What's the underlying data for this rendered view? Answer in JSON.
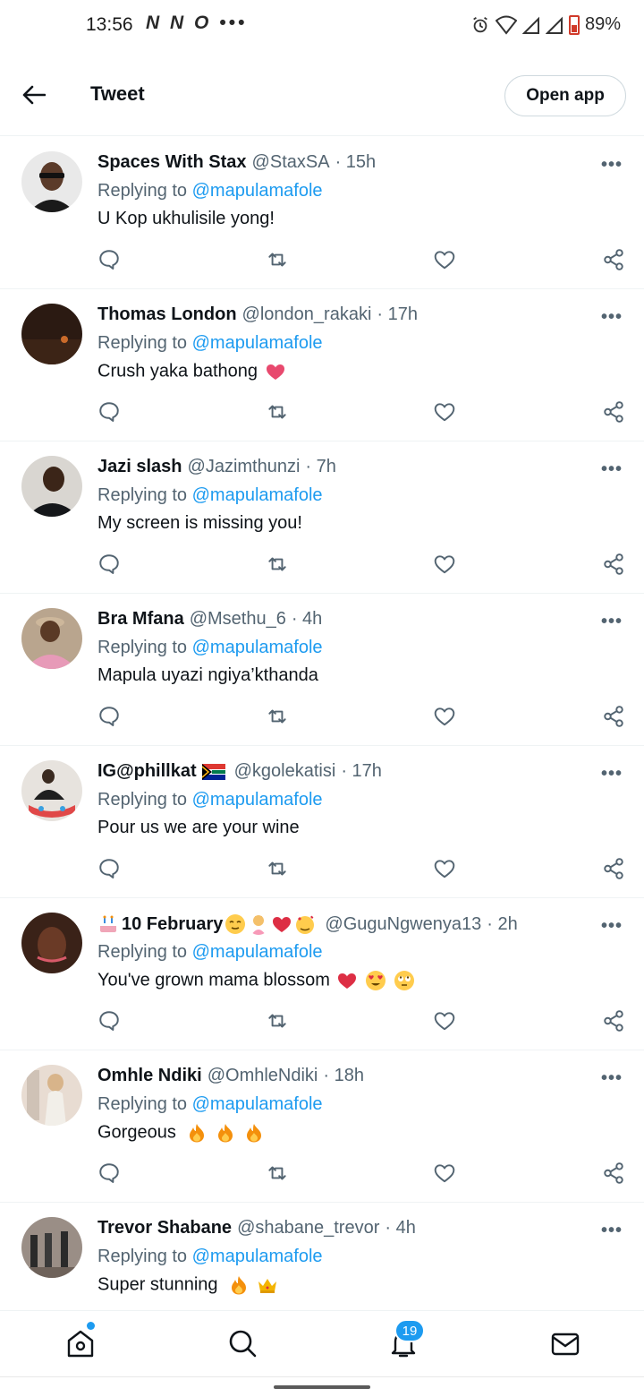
{
  "status_bar": {
    "time": "13:56",
    "left_icons": "N N O •••",
    "battery": "89%"
  },
  "header": {
    "title": "Tweet",
    "open_app": "Open app"
  },
  "replying_label": "Replying to",
  "tweets": [
    {
      "name": "Spaces With Stax",
      "handle": "@StaxSA",
      "time": "· 15h",
      "mention": "@mapulamafole",
      "text": "U Kop ukhulisile yong!",
      "avatar_color": "#3a3a3a"
    },
    {
      "name": "Thomas London",
      "handle": "@london_rakaki",
      "time": "· 17h",
      "mention": "@mapulamafole",
      "text": "Crush yaka bathong",
      "avatar_color": "#2b1a12"
    },
    {
      "name": "Jazi slash",
      "handle": "@Jazimthunzi",
      "time": "· 7h",
      "mention": "@mapulamafole",
      "text": "My screen is missing you!",
      "avatar_color": "#4a4238"
    },
    {
      "name": "Bra Mfana",
      "handle": "@Msethu_6",
      "time": "· 4h",
      "mention": "@mapulamafole",
      "text": "Mapula uyazi ngiya’kthanda",
      "avatar_color": "#a58a6e"
    },
    {
      "name": "IG@phillkat",
      "handle": "@kgolekatisi",
      "time": "· 17h",
      "mention": "@mapulamafole",
      "text": "Pour us we are your wine",
      "avatar_color": "#c9c3bd"
    },
    {
      "name": "10 February",
      "handle": "@GuguNgwenya13",
      "time": "· 2h",
      "mention": "@mapulamafole",
      "text": "You've grown mama blossom",
      "avatar_color": "#5a3426"
    },
    {
      "name": "Omhle Ndiki",
      "handle": "@OmhleNdiki",
      "time": "· 18h",
      "mention": "@mapulamafole",
      "text": "Gorgeous",
      "avatar_color": "#d8c8bc"
    },
    {
      "name": "Trevor Shabane",
      "handle": "@shabane_trevor",
      "time": "· 4h",
      "mention": "@mapulamafole",
      "text": "Super stunning",
      "avatar_color": "#7b6e66"
    }
  ],
  "nav": {
    "notification_count": "19"
  },
  "colors": {
    "accent": "#1d9bf0",
    "secondary_text": "#536471",
    "like_heart": "#e0245e",
    "fire": "#f4900c"
  }
}
